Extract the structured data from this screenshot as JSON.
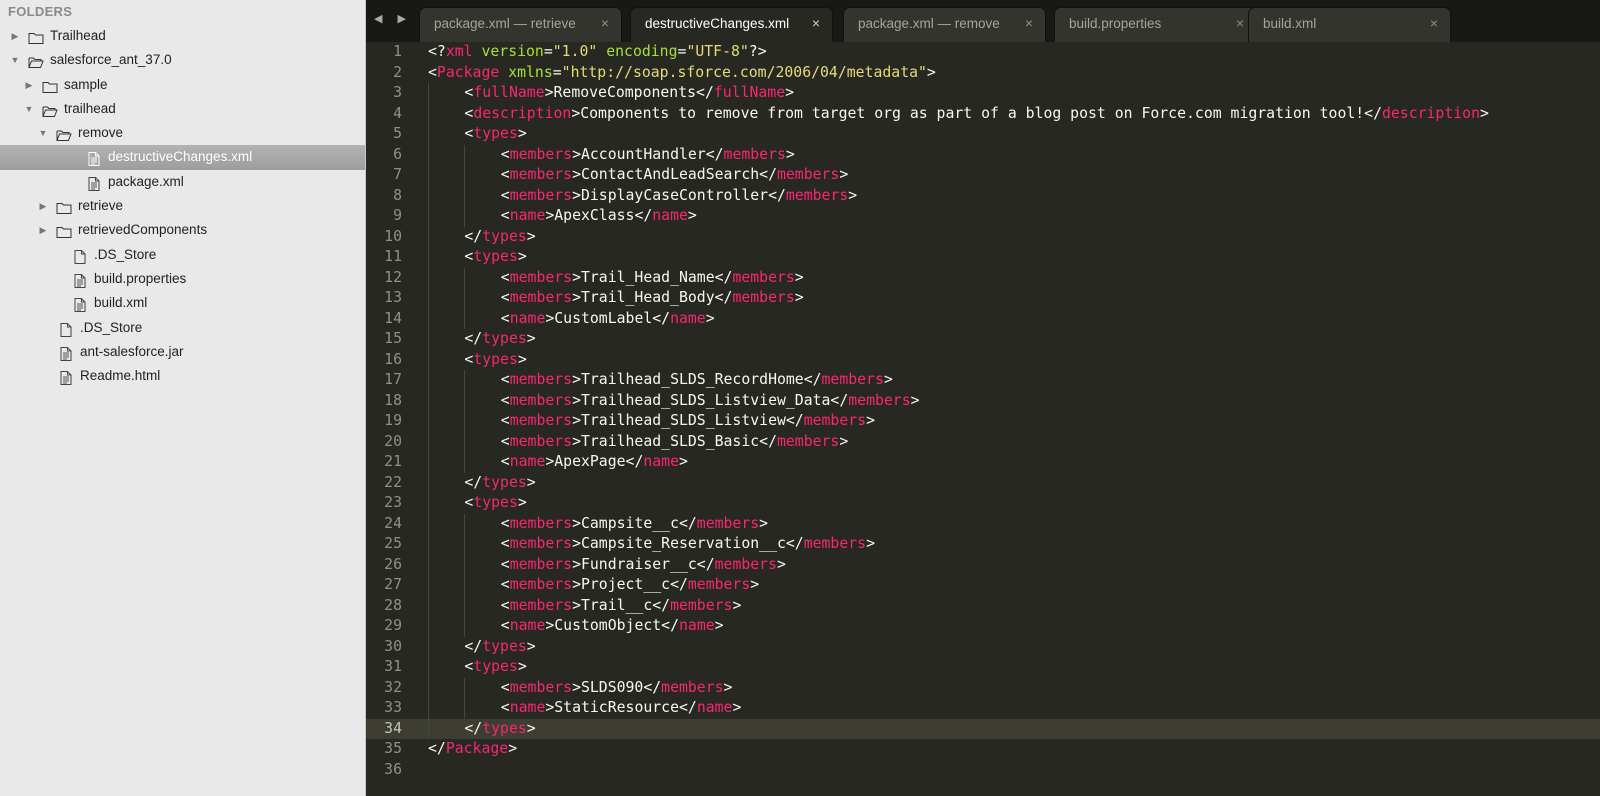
{
  "sidebar": {
    "header": "FOLDERS",
    "items": [
      {
        "label": "Trailhead",
        "type": "folder",
        "state": "collapsed",
        "depth": 0
      },
      {
        "label": "salesforce_ant_37.0",
        "type": "folder",
        "state": "expanded",
        "depth": 0
      },
      {
        "label": "sample",
        "type": "folder",
        "state": "collapsed",
        "depth": 1
      },
      {
        "label": "trailhead",
        "type": "folder",
        "state": "expanded",
        "depth": 1
      },
      {
        "label": "remove",
        "type": "folder",
        "state": "expanded",
        "depth": 2
      },
      {
        "label": "destructiveChanges.xml",
        "type": "code-file",
        "depth": 3,
        "selected": true
      },
      {
        "label": "package.xml",
        "type": "code-file",
        "depth": 3
      },
      {
        "label": "retrieve",
        "type": "folder",
        "state": "collapsed",
        "depth": 2
      },
      {
        "label": "retrievedComponents",
        "type": "folder",
        "state": "collapsed",
        "depth": 2
      },
      {
        "label": ".DS_Store",
        "type": "file",
        "depth": 2
      },
      {
        "label": "build.properties",
        "type": "code-file",
        "depth": 2
      },
      {
        "label": "build.xml",
        "type": "code-file",
        "depth": 2
      },
      {
        "label": ".DS_Store",
        "type": "file",
        "depth": 1
      },
      {
        "label": "ant-salesforce.jar",
        "type": "code-file",
        "depth": 1
      },
      {
        "label": "Readme.html",
        "type": "code-file",
        "depth": 1
      }
    ]
  },
  "tabs": [
    {
      "label": "package.xml — retrieve",
      "active": false
    },
    {
      "label": "destructiveChanges.xml",
      "active": true
    },
    {
      "label": "package.xml — remove",
      "active": false
    },
    {
      "label": "build.properties",
      "active": false
    },
    {
      "label": "build.xml",
      "active": false
    }
  ],
  "tab_close_glyph": "×",
  "nav_arrows": "◀ ▶",
  "current_line": 34,
  "colors": {
    "tag": "#f92672",
    "attr": "#a6e22e",
    "string": "#e6db74",
    "text": "#f8f8f2",
    "background": "#272822"
  },
  "code_lines": [
    {
      "indent": 0,
      "tokens": [
        [
          "txt",
          "<?"
        ],
        [
          "tag",
          "xml"
        ],
        [
          "txt",
          " "
        ],
        [
          "attr",
          "version"
        ],
        [
          "txt",
          "="
        ],
        [
          "str",
          "\"1.0\""
        ],
        [
          "txt",
          " "
        ],
        [
          "attr",
          "encoding"
        ],
        [
          "txt",
          "="
        ],
        [
          "str",
          "\"UTF-8\""
        ],
        [
          "txt",
          "?>"
        ]
      ]
    },
    {
      "indent": 0,
      "tokens": [
        [
          "txt",
          "<"
        ],
        [
          "tag",
          "Package"
        ],
        [
          "txt",
          " "
        ],
        [
          "attr",
          "xmlns"
        ],
        [
          "txt",
          "="
        ],
        [
          "str",
          "\"http://soap.sforce.com/2006/04/metadata\""
        ],
        [
          "txt",
          ">"
        ]
      ]
    },
    {
      "indent": 1,
      "tokens": [
        [
          "txt",
          "<"
        ],
        [
          "tag",
          "fullName"
        ],
        [
          "txt",
          ">RemoveComponents</"
        ],
        [
          "tag",
          "fullName"
        ],
        [
          "txt",
          ">"
        ]
      ]
    },
    {
      "indent": 1,
      "tokens": [
        [
          "txt",
          "<"
        ],
        [
          "tag",
          "description"
        ],
        [
          "txt",
          ">Components to remove from target org as part of a blog post on Force.com migration tool!</"
        ],
        [
          "tag",
          "description"
        ],
        [
          "txt",
          ">"
        ]
      ]
    },
    {
      "indent": 1,
      "tokens": [
        [
          "txt",
          "<"
        ],
        [
          "tag",
          "types"
        ],
        [
          "txt",
          ">"
        ]
      ]
    },
    {
      "indent": 2,
      "tokens": [
        [
          "txt",
          "<"
        ],
        [
          "tag",
          "members"
        ],
        [
          "txt",
          ">AccountHandler</"
        ],
        [
          "tag",
          "members"
        ],
        [
          "txt",
          ">"
        ]
      ]
    },
    {
      "indent": 2,
      "tokens": [
        [
          "txt",
          "<"
        ],
        [
          "tag",
          "members"
        ],
        [
          "txt",
          ">ContactAndLeadSearch</"
        ],
        [
          "tag",
          "members"
        ],
        [
          "txt",
          ">"
        ]
      ]
    },
    {
      "indent": 2,
      "tokens": [
        [
          "txt",
          "<"
        ],
        [
          "tag",
          "members"
        ],
        [
          "txt",
          ">DisplayCaseController</"
        ],
        [
          "tag",
          "members"
        ],
        [
          "txt",
          ">"
        ]
      ]
    },
    {
      "indent": 2,
      "tokens": [
        [
          "txt",
          "<"
        ],
        [
          "tag",
          "name"
        ],
        [
          "txt",
          ">ApexClass</"
        ],
        [
          "tag",
          "name"
        ],
        [
          "txt",
          ">"
        ]
      ]
    },
    {
      "indent": 1,
      "tokens": [
        [
          "txt",
          "</"
        ],
        [
          "tag",
          "types"
        ],
        [
          "txt",
          ">"
        ]
      ]
    },
    {
      "indent": 1,
      "tokens": [
        [
          "txt",
          "<"
        ],
        [
          "tag",
          "types"
        ],
        [
          "txt",
          ">"
        ]
      ]
    },
    {
      "indent": 2,
      "tokens": [
        [
          "txt",
          "<"
        ],
        [
          "tag",
          "members"
        ],
        [
          "txt",
          ">Trail_Head_Name</"
        ],
        [
          "tag",
          "members"
        ],
        [
          "txt",
          ">"
        ]
      ]
    },
    {
      "indent": 2,
      "tokens": [
        [
          "txt",
          "<"
        ],
        [
          "tag",
          "members"
        ],
        [
          "txt",
          ">Trail_Head_Body</"
        ],
        [
          "tag",
          "members"
        ],
        [
          "txt",
          ">"
        ]
      ]
    },
    {
      "indent": 2,
      "tokens": [
        [
          "txt",
          "<"
        ],
        [
          "tag",
          "name"
        ],
        [
          "txt",
          ">CustomLabel</"
        ],
        [
          "tag",
          "name"
        ],
        [
          "txt",
          ">"
        ]
      ]
    },
    {
      "indent": 1,
      "tokens": [
        [
          "txt",
          "</"
        ],
        [
          "tag",
          "types"
        ],
        [
          "txt",
          ">"
        ]
      ]
    },
    {
      "indent": 1,
      "tokens": [
        [
          "txt",
          "<"
        ],
        [
          "tag",
          "types"
        ],
        [
          "txt",
          ">"
        ]
      ]
    },
    {
      "indent": 2,
      "tokens": [
        [
          "txt",
          "<"
        ],
        [
          "tag",
          "members"
        ],
        [
          "txt",
          ">Trailhead_SLDS_RecordHome</"
        ],
        [
          "tag",
          "members"
        ],
        [
          "txt",
          ">"
        ]
      ]
    },
    {
      "indent": 2,
      "tokens": [
        [
          "txt",
          "<"
        ],
        [
          "tag",
          "members"
        ],
        [
          "txt",
          ">Trailhead_SLDS_Listview_Data</"
        ],
        [
          "tag",
          "members"
        ],
        [
          "txt",
          ">"
        ]
      ]
    },
    {
      "indent": 2,
      "tokens": [
        [
          "txt",
          "<"
        ],
        [
          "tag",
          "members"
        ],
        [
          "txt",
          ">Trailhead_SLDS_Listview</"
        ],
        [
          "tag",
          "members"
        ],
        [
          "txt",
          ">"
        ]
      ]
    },
    {
      "indent": 2,
      "tokens": [
        [
          "txt",
          "<"
        ],
        [
          "tag",
          "members"
        ],
        [
          "txt",
          ">Trailhead_SLDS_Basic</"
        ],
        [
          "tag",
          "members"
        ],
        [
          "txt",
          ">"
        ]
      ]
    },
    {
      "indent": 2,
      "tokens": [
        [
          "txt",
          "<"
        ],
        [
          "tag",
          "name"
        ],
        [
          "txt",
          ">ApexPage</"
        ],
        [
          "tag",
          "name"
        ],
        [
          "txt",
          ">"
        ]
      ]
    },
    {
      "indent": 1,
      "tokens": [
        [
          "txt",
          "</"
        ],
        [
          "tag",
          "types"
        ],
        [
          "txt",
          ">"
        ]
      ]
    },
    {
      "indent": 1,
      "tokens": [
        [
          "txt",
          "<"
        ],
        [
          "tag",
          "types"
        ],
        [
          "txt",
          ">"
        ]
      ]
    },
    {
      "indent": 2,
      "tokens": [
        [
          "txt",
          "<"
        ],
        [
          "tag",
          "members"
        ],
        [
          "txt",
          ">Campsite__c</"
        ],
        [
          "tag",
          "members"
        ],
        [
          "txt",
          ">"
        ]
      ]
    },
    {
      "indent": 2,
      "tokens": [
        [
          "txt",
          "<"
        ],
        [
          "tag",
          "members"
        ],
        [
          "txt",
          ">Campsite_Reservation__c</"
        ],
        [
          "tag",
          "members"
        ],
        [
          "txt",
          ">"
        ]
      ]
    },
    {
      "indent": 2,
      "tokens": [
        [
          "txt",
          "<"
        ],
        [
          "tag",
          "members"
        ],
        [
          "txt",
          ">Fundraiser__c</"
        ],
        [
          "tag",
          "members"
        ],
        [
          "txt",
          ">"
        ]
      ]
    },
    {
      "indent": 2,
      "tokens": [
        [
          "txt",
          "<"
        ],
        [
          "tag",
          "members"
        ],
        [
          "txt",
          ">Project__c</"
        ],
        [
          "tag",
          "members"
        ],
        [
          "txt",
          ">"
        ]
      ]
    },
    {
      "indent": 2,
      "tokens": [
        [
          "txt",
          "<"
        ],
        [
          "tag",
          "members"
        ],
        [
          "txt",
          ">Trail__c</"
        ],
        [
          "tag",
          "members"
        ],
        [
          "txt",
          ">"
        ]
      ]
    },
    {
      "indent": 2,
      "tokens": [
        [
          "txt",
          "<"
        ],
        [
          "tag",
          "name"
        ],
        [
          "txt",
          ">CustomObject</"
        ],
        [
          "tag",
          "name"
        ],
        [
          "txt",
          ">"
        ]
      ]
    },
    {
      "indent": 1,
      "tokens": [
        [
          "txt",
          "</"
        ],
        [
          "tag",
          "types"
        ],
        [
          "txt",
          ">"
        ]
      ]
    },
    {
      "indent": 1,
      "tokens": [
        [
          "txt",
          "<"
        ],
        [
          "tag",
          "types"
        ],
        [
          "txt",
          ">"
        ]
      ]
    },
    {
      "indent": 2,
      "tokens": [
        [
          "txt",
          "<"
        ],
        [
          "tag",
          "members"
        ],
        [
          "txt",
          ">SLDS090</"
        ],
        [
          "tag",
          "members"
        ],
        [
          "txt",
          ">"
        ]
      ]
    },
    {
      "indent": 2,
      "tokens": [
        [
          "txt",
          "<"
        ],
        [
          "tag",
          "name"
        ],
        [
          "txt",
          ">StaticResource</"
        ],
        [
          "tag",
          "name"
        ],
        [
          "txt",
          ">"
        ]
      ]
    },
    {
      "indent": 1,
      "tokens": [
        [
          "txt",
          "</"
        ],
        [
          "tag",
          "types"
        ],
        [
          "txt",
          ">"
        ]
      ]
    },
    {
      "indent": 0,
      "tokens": [
        [
          "txt",
          "</"
        ],
        [
          "tag",
          "Package"
        ],
        [
          "txt",
          ">"
        ]
      ]
    },
    {
      "indent": 0,
      "tokens": []
    }
  ]
}
